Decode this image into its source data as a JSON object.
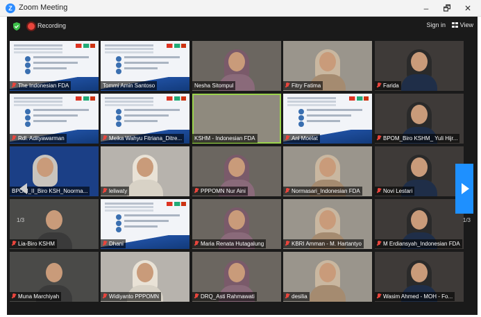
{
  "window": {
    "title": "Zoom Meeting",
    "controls": {
      "minimize": "–",
      "maximize": "🗗",
      "close": "✕"
    }
  },
  "toolbar": {
    "recording_label": "Recording",
    "sign_in": "Sign in",
    "view": "View"
  },
  "pagination": {
    "left": "1/3",
    "right": "1/3"
  },
  "participants": [
    {
      "name": "The  Indonesian FDA",
      "muted": true,
      "kind": "slide"
    },
    {
      "name": "Tommi Amin Santoso",
      "muted": false,
      "kind": "slide"
    },
    {
      "name": "Nesha Sitompul",
      "muted": false,
      "kind": "cam"
    },
    {
      "name": "Fitry Fatima",
      "muted": true,
      "kind": "cam"
    },
    {
      "name": "Farida",
      "muted": true,
      "kind": "cam"
    },
    {
      "name": "Rdl. Adityawarman",
      "muted": true,
      "kind": "slide"
    },
    {
      "name": "Meika Wahyu Fitriana_Ditre...",
      "muted": true,
      "kind": "slide"
    },
    {
      "name": "KSHM - Indonesian FDA",
      "muted": false,
      "kind": "room"
    },
    {
      "name": "Anl Moelat",
      "muted": true,
      "kind": "slide"
    },
    {
      "name": "BPOM_Biro KSHM_ Yuli Hijr...",
      "muted": true,
      "kind": "cam"
    },
    {
      "name": "BPOM_II_Biro KSH_Noorma...",
      "muted": false,
      "kind": "blue"
    },
    {
      "name": "leliwaty",
      "muted": true,
      "kind": "cam"
    },
    {
      "name": "PPPOMN Nur Aini",
      "muted": true,
      "kind": "cam"
    },
    {
      "name": "Normasari_Indonesian FDA",
      "muted": true,
      "kind": "cam"
    },
    {
      "name": "Novi Lestari",
      "muted": true,
      "kind": "cam"
    },
    {
      "name": "Lia-Biro KSHM",
      "muted": true,
      "kind": "cam"
    },
    {
      "name": "Dhani",
      "muted": true,
      "kind": "slide"
    },
    {
      "name": "Maria Renata Hutagalung",
      "muted": true,
      "kind": "cam"
    },
    {
      "name": "KBRI Amman - M. Hartantyo",
      "muted": true,
      "kind": "cam"
    },
    {
      "name": "M Erdiansyah_Indonesian FDA",
      "muted": true,
      "kind": "cam"
    },
    {
      "name": "Muna Marchiyah",
      "muted": true,
      "kind": "cam"
    },
    {
      "name": "Widiyanto PPPOMN",
      "muted": true,
      "kind": "cam"
    },
    {
      "name": "DRQ_Asti Rahmawati",
      "muted": true,
      "kind": "cam"
    },
    {
      "name": "desilia",
      "muted": true,
      "kind": "cam"
    },
    {
      "name": "Wasim Ahmed - MOH - Fo...",
      "muted": true,
      "kind": "cam"
    }
  ]
}
